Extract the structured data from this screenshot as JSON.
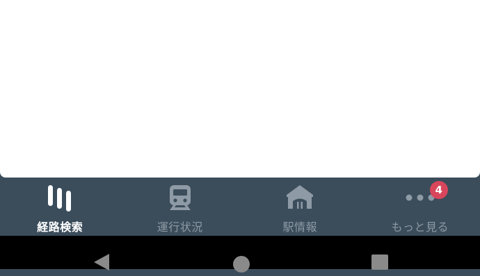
{
  "tabbar": {
    "tabs": [
      {
        "label": "経路検索",
        "icon": "route-search-icon",
        "active": true
      },
      {
        "label": "運行状況",
        "icon": "train-icon",
        "active": false
      },
      {
        "label": "駅情報",
        "icon": "station-icon",
        "active": false
      },
      {
        "label": "もっと見る",
        "icon": "more-dots-icon",
        "active": false,
        "badge": "4"
      }
    ]
  },
  "colors": {
    "tabbar_bg": "#3b4d5b",
    "active": "#ffffff",
    "inactive": "#8e9aa5",
    "badge": "#d9465b"
  },
  "system_nav": {
    "buttons": [
      "back-icon",
      "home-icon",
      "recents-icon"
    ]
  }
}
